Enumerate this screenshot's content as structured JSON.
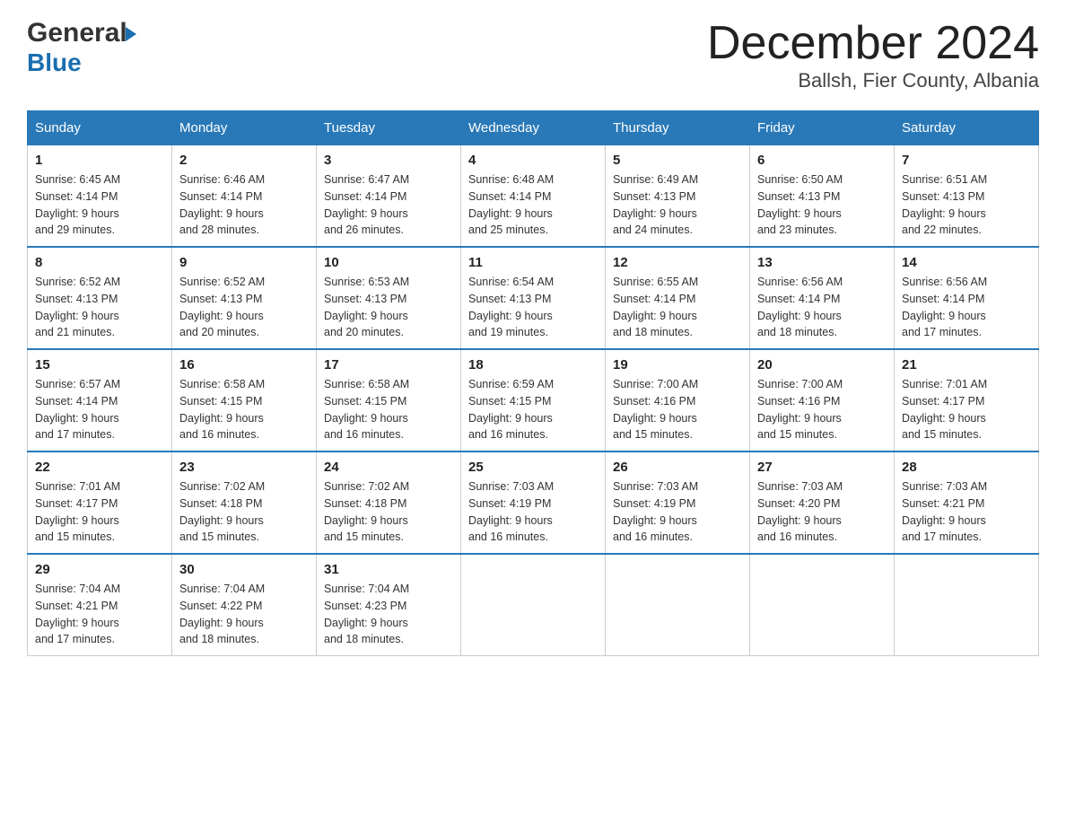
{
  "header": {
    "logo_line1": "General",
    "logo_arrow": "▶",
    "logo_line2": "Blue",
    "month_title": "December 2024",
    "location": "Ballsh, Fier County, Albania"
  },
  "days_of_week": [
    "Sunday",
    "Monday",
    "Tuesday",
    "Wednesday",
    "Thursday",
    "Friday",
    "Saturday"
  ],
  "weeks": [
    [
      {
        "day": "1",
        "sunrise": "6:45 AM",
        "sunset": "4:14 PM",
        "daylight": "9 hours and 29 minutes."
      },
      {
        "day": "2",
        "sunrise": "6:46 AM",
        "sunset": "4:14 PM",
        "daylight": "9 hours and 28 minutes."
      },
      {
        "day": "3",
        "sunrise": "6:47 AM",
        "sunset": "4:14 PM",
        "daylight": "9 hours and 26 minutes."
      },
      {
        "day": "4",
        "sunrise": "6:48 AM",
        "sunset": "4:14 PM",
        "daylight": "9 hours and 25 minutes."
      },
      {
        "day": "5",
        "sunrise": "6:49 AM",
        "sunset": "4:13 PM",
        "daylight": "9 hours and 24 minutes."
      },
      {
        "day": "6",
        "sunrise": "6:50 AM",
        "sunset": "4:13 PM",
        "daylight": "9 hours and 23 minutes."
      },
      {
        "day": "7",
        "sunrise": "6:51 AM",
        "sunset": "4:13 PM",
        "daylight": "9 hours and 22 minutes."
      }
    ],
    [
      {
        "day": "8",
        "sunrise": "6:52 AM",
        "sunset": "4:13 PM",
        "daylight": "9 hours and 21 minutes."
      },
      {
        "day": "9",
        "sunrise": "6:52 AM",
        "sunset": "4:13 PM",
        "daylight": "9 hours and 20 minutes."
      },
      {
        "day": "10",
        "sunrise": "6:53 AM",
        "sunset": "4:13 PM",
        "daylight": "9 hours and 20 minutes."
      },
      {
        "day": "11",
        "sunrise": "6:54 AM",
        "sunset": "4:13 PM",
        "daylight": "9 hours and 19 minutes."
      },
      {
        "day": "12",
        "sunrise": "6:55 AM",
        "sunset": "4:14 PM",
        "daylight": "9 hours and 18 minutes."
      },
      {
        "day": "13",
        "sunrise": "6:56 AM",
        "sunset": "4:14 PM",
        "daylight": "9 hours and 18 minutes."
      },
      {
        "day": "14",
        "sunrise": "6:56 AM",
        "sunset": "4:14 PM",
        "daylight": "9 hours and 17 minutes."
      }
    ],
    [
      {
        "day": "15",
        "sunrise": "6:57 AM",
        "sunset": "4:14 PM",
        "daylight": "9 hours and 17 minutes."
      },
      {
        "day": "16",
        "sunrise": "6:58 AM",
        "sunset": "4:15 PM",
        "daylight": "9 hours and 16 minutes."
      },
      {
        "day": "17",
        "sunrise": "6:58 AM",
        "sunset": "4:15 PM",
        "daylight": "9 hours and 16 minutes."
      },
      {
        "day": "18",
        "sunrise": "6:59 AM",
        "sunset": "4:15 PM",
        "daylight": "9 hours and 16 minutes."
      },
      {
        "day": "19",
        "sunrise": "7:00 AM",
        "sunset": "4:16 PM",
        "daylight": "9 hours and 15 minutes."
      },
      {
        "day": "20",
        "sunrise": "7:00 AM",
        "sunset": "4:16 PM",
        "daylight": "9 hours and 15 minutes."
      },
      {
        "day": "21",
        "sunrise": "7:01 AM",
        "sunset": "4:17 PM",
        "daylight": "9 hours and 15 minutes."
      }
    ],
    [
      {
        "day": "22",
        "sunrise": "7:01 AM",
        "sunset": "4:17 PM",
        "daylight": "9 hours and 15 minutes."
      },
      {
        "day": "23",
        "sunrise": "7:02 AM",
        "sunset": "4:18 PM",
        "daylight": "9 hours and 15 minutes."
      },
      {
        "day": "24",
        "sunrise": "7:02 AM",
        "sunset": "4:18 PM",
        "daylight": "9 hours and 15 minutes."
      },
      {
        "day": "25",
        "sunrise": "7:03 AM",
        "sunset": "4:19 PM",
        "daylight": "9 hours and 16 minutes."
      },
      {
        "day": "26",
        "sunrise": "7:03 AM",
        "sunset": "4:19 PM",
        "daylight": "9 hours and 16 minutes."
      },
      {
        "day": "27",
        "sunrise": "7:03 AM",
        "sunset": "4:20 PM",
        "daylight": "9 hours and 16 minutes."
      },
      {
        "day": "28",
        "sunrise": "7:03 AM",
        "sunset": "4:21 PM",
        "daylight": "9 hours and 17 minutes."
      }
    ],
    [
      {
        "day": "29",
        "sunrise": "7:04 AM",
        "sunset": "4:21 PM",
        "daylight": "9 hours and 17 minutes."
      },
      {
        "day": "30",
        "sunrise": "7:04 AM",
        "sunset": "4:22 PM",
        "daylight": "9 hours and 18 minutes."
      },
      {
        "day": "31",
        "sunrise": "7:04 AM",
        "sunset": "4:23 PM",
        "daylight": "9 hours and 18 minutes."
      },
      null,
      null,
      null,
      null
    ]
  ],
  "labels": {
    "sunrise": "Sunrise:",
    "sunset": "Sunset:",
    "daylight": "Daylight:"
  }
}
